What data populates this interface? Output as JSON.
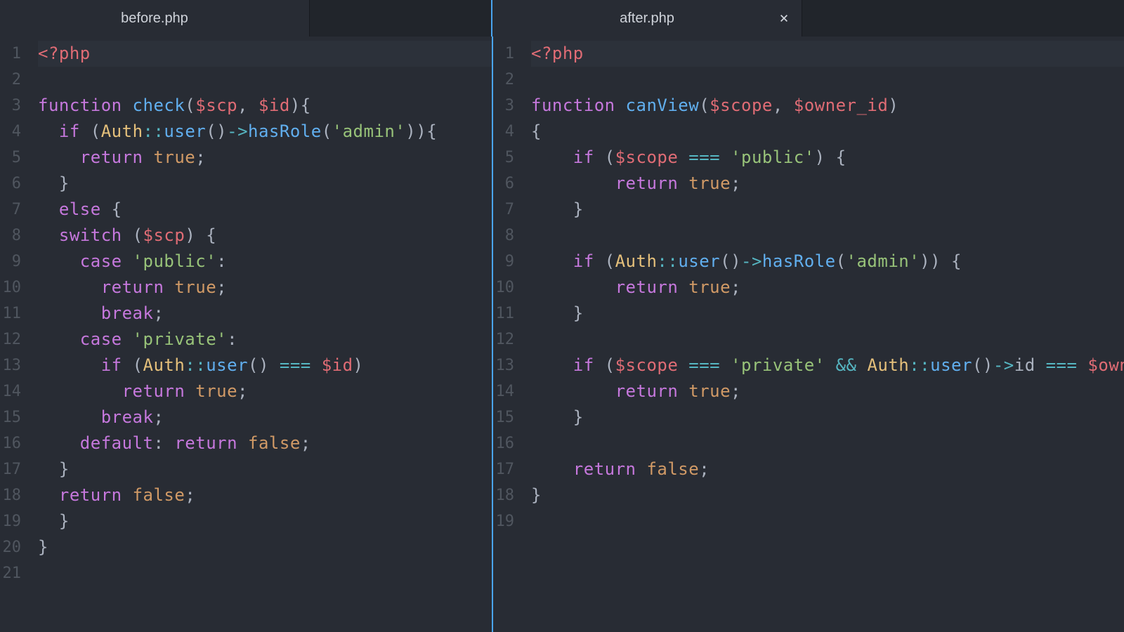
{
  "tabs": {
    "left": {
      "title": "before.php",
      "closable": false
    },
    "right": {
      "title": "after.php",
      "closable": true
    }
  },
  "colors": {
    "bg": "#282c34",
    "tabbar": "#21252b",
    "divider": "#4aa5f0",
    "gutter": "#50565f",
    "keyword": "#c678dd",
    "func": "#61afef",
    "var": "#e06c75",
    "class": "#e5c07b",
    "string": "#98c379",
    "bool": "#d19a66",
    "op": "#56b6c2",
    "text": "#abb2bf"
  },
  "left_pane": {
    "filename": "before.php",
    "line_count": 21,
    "source": [
      "<?php",
      "",
      "function check($scp, $id){",
      "  if (Auth::user()->hasRole('admin')){",
      "    return true;",
      "  }",
      "  else {",
      "  switch ($scp) {",
      "    case 'public':",
      "      return true;",
      "      break;",
      "    case 'private':",
      "      if (Auth::user() === $id)",
      "        return true;",
      "      break;",
      "    default: return false;",
      "  }",
      "  return false;",
      "  }",
      "}",
      ""
    ]
  },
  "right_pane": {
    "filename": "after.php",
    "line_count": 19,
    "source": [
      "<?php",
      "",
      "function canView($scope, $owner_id)",
      "{",
      "    if ($scope === 'public') {",
      "        return true;",
      "    }",
      "",
      "    if (Auth::user()->hasRole('admin')) {",
      "        return true;",
      "    }",
      "",
      "    if ($scope === 'private' && Auth::user()->id === $owner_id) {",
      "        return true;",
      "    }",
      "",
      "    return false;",
      "}",
      ""
    ]
  }
}
